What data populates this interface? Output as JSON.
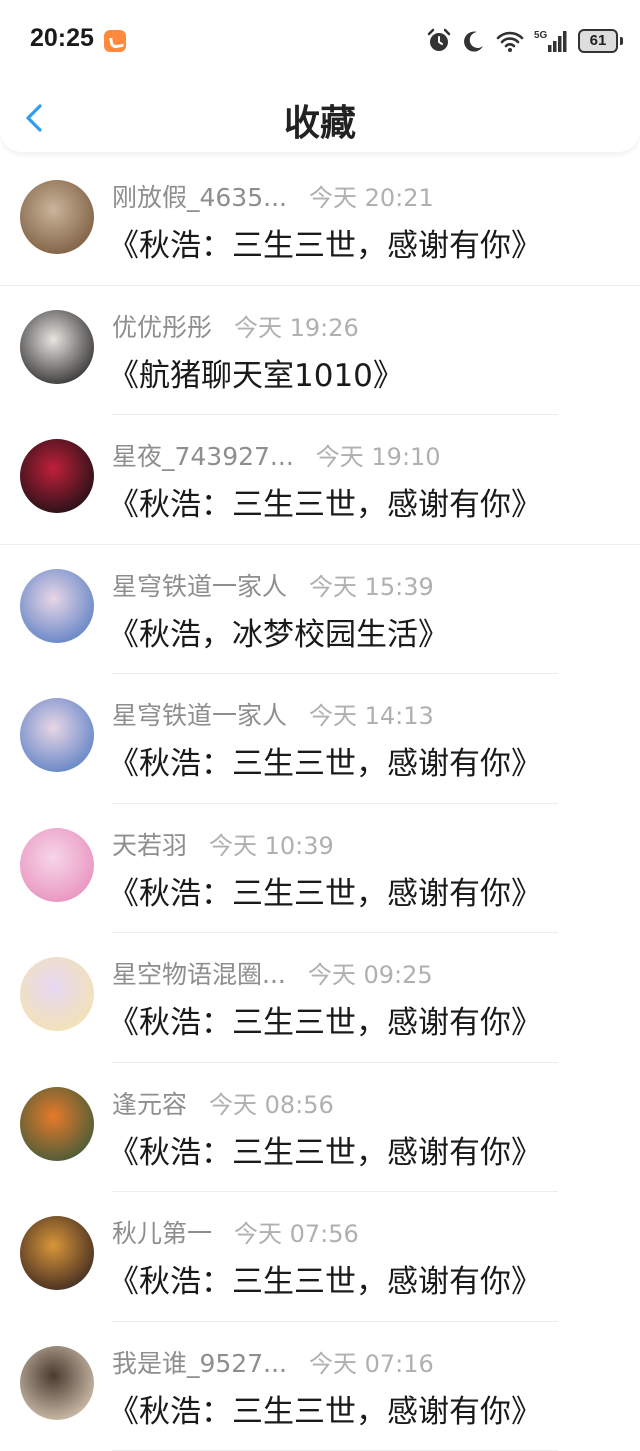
{
  "status_bar": {
    "time": "20:25",
    "battery": "61",
    "icons": [
      "app-badge-icon",
      "alarm-icon",
      "moon-icon",
      "wifi-icon",
      "signal-5g-icon",
      "battery-icon"
    ]
  },
  "header": {
    "title": "收藏",
    "back_icon": "chevron-left-icon",
    "accent": "#2f9cf0"
  },
  "items": [
    {
      "name": "刚放假_4635...",
      "time": "今天 20:21",
      "message": "《秋浩：三生三世，感谢有你》",
      "avatar_colors": [
        "#7a5a3e",
        "#c9b59a"
      ]
    },
    {
      "name": "优优彤彤",
      "time": "今天 19:26",
      "message": "《航猪聊天室1010》",
      "avatar_colors": [
        "#2a2a2a",
        "#e8e4e0"
      ]
    },
    {
      "name": "星夜_743927...",
      "time": "今天 19:10",
      "message": "《秋浩：三生三世，感谢有你》",
      "avatar_colors": [
        "#1a1014",
        "#c0203a"
      ]
    },
    {
      "name": "星穹铁道一家人",
      "time": "今天 15:39",
      "message": "《秋浩，冰梦校园生活》",
      "avatar_colors": [
        "#5a7fc4",
        "#e8d6e6"
      ]
    },
    {
      "name": "星穹铁道一家人",
      "time": "今天 14:13",
      "message": "《秋浩：三生三世，感谢有你》",
      "avatar_colors": [
        "#5a7fc4",
        "#e8d6e6"
      ]
    },
    {
      "name": "天若羽",
      "time": "今天 10:39",
      "message": "《秋浩：三生三世，感谢有你》",
      "avatar_colors": [
        "#e88fbc",
        "#f6d6e8"
      ]
    },
    {
      "name": "星空物语混圈...",
      "time": "今天 09:25",
      "message": "《秋浩：三生三世，感谢有你》",
      "avatar_colors": [
        "#f4e3b0",
        "#e6d8f4"
      ]
    },
    {
      "name": "逢元容",
      "time": "今天 08:56",
      "message": "《秋浩：三生三世，感谢有你》",
      "avatar_colors": [
        "#3d5a3a",
        "#e67a2a"
      ]
    },
    {
      "name": "秋儿第一",
      "time": "今天 07:56",
      "message": "《秋浩：三生三世，感谢有你》",
      "avatar_colors": [
        "#3a2620",
        "#d8963a"
      ]
    },
    {
      "name": "我是谁_9527...",
      "time": "今天 07:16",
      "message": "《秋浩：三生三世，感谢有你》",
      "avatar_colors": [
        "#d8c8b4",
        "#4a3a30"
      ]
    }
  ]
}
